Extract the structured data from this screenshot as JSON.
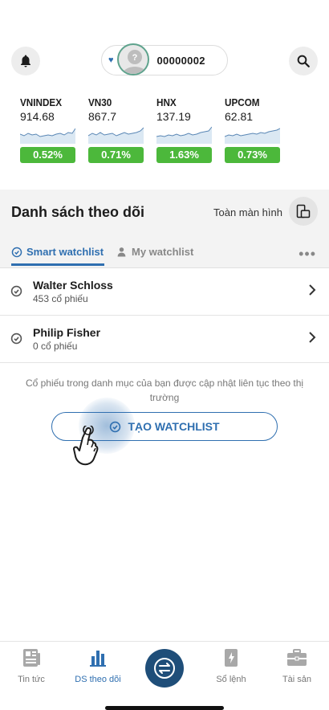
{
  "header": {
    "account_number": "00000002",
    "avatar_glyph": "?"
  },
  "indices": [
    {
      "name": "VNINDEX",
      "value": "914.68",
      "change": "0.52%"
    },
    {
      "name": "VN30",
      "value": "867.7",
      "change": "0.71%"
    },
    {
      "name": "HNX",
      "value": "137.19",
      "change": "1.63%"
    },
    {
      "name": "UPCOM",
      "value": "62.81",
      "change": "0.73%"
    }
  ],
  "watchlist": {
    "title": "Danh sách theo dõi",
    "fullscreen_label": "Toàn màn hình",
    "tabs": {
      "smart": "Smart watchlist",
      "my": "My watchlist"
    },
    "more_label": "•••",
    "items": [
      {
        "name": "Walter Schloss",
        "count": "453 cổ phiếu"
      },
      {
        "name": "Philip Fisher",
        "count": "0 cổ phiếu"
      }
    ],
    "info_text": "Cổ phiếu trong danh mục của bạn được cập nhật liên tục theo thị trường",
    "create_button": "TẠO WATCHLIST"
  },
  "bottom_nav": {
    "items": [
      {
        "label": "Tin tức"
      },
      {
        "label": "DS theo dõi"
      },
      {
        "label": "Sổ lệnh"
      },
      {
        "label": "Tài sản"
      }
    ]
  },
  "colors": {
    "accent": "#2f6fb0",
    "positive": "#4cb83b",
    "center_button": "#1f4e79"
  }
}
